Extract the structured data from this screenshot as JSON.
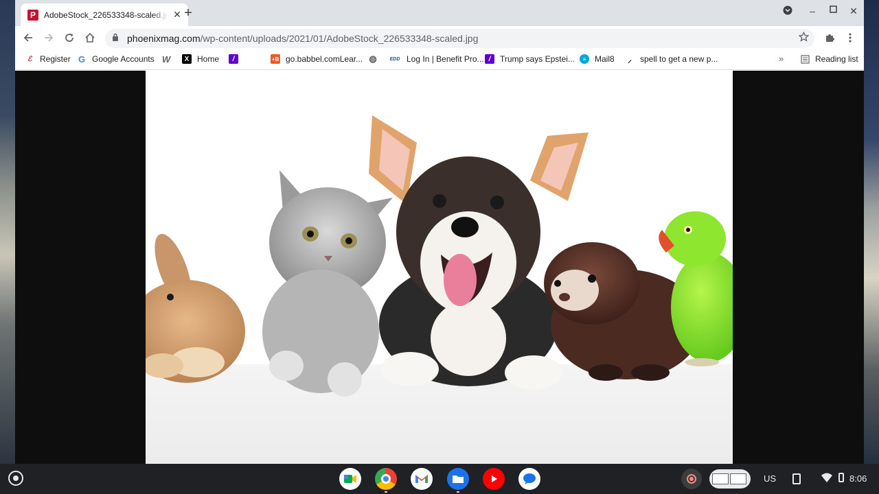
{
  "tab": {
    "title": "AdobeStock_226533348-scaled.jpg",
    "favicon_letter": "P"
  },
  "toolbar": {
    "url_host": "phoenixmag.com",
    "url_path": "/wp-content/uploads/2021/01/AdobeStock_226533348-scaled.jpg"
  },
  "bookmarks": [
    {
      "label": "Register",
      "icon": "register-icon"
    },
    {
      "label": "Google Accounts",
      "icon": "google-icon"
    },
    {
      "label": "",
      "icon": "w-icon"
    },
    {
      "label": "Home",
      "icon": "x-icon"
    },
    {
      "label": "",
      "icon": "yahoo-icon"
    },
    {
      "label": "go.babbel.comLear...",
      "icon": "babbel-icon"
    },
    {
      "label": "",
      "icon": "globe-icon"
    },
    {
      "label": "Log In | Benefit Pro...",
      "icon": "edd-icon"
    },
    {
      "label": "Trump says Epstei...",
      "icon": "yahoo-icon"
    },
    {
      "label": "Mail8",
      "icon": "att-icon"
    },
    {
      "label": "spell to get a new p...",
      "icon": "wand-icon"
    }
  ],
  "reading_list": "Reading list",
  "colors": {
    "tabstrip": "#dee1e6",
    "accent": "#1a73e8",
    "shelf": "#202124"
  },
  "tray": {
    "ime": "US",
    "time": "8:06"
  }
}
